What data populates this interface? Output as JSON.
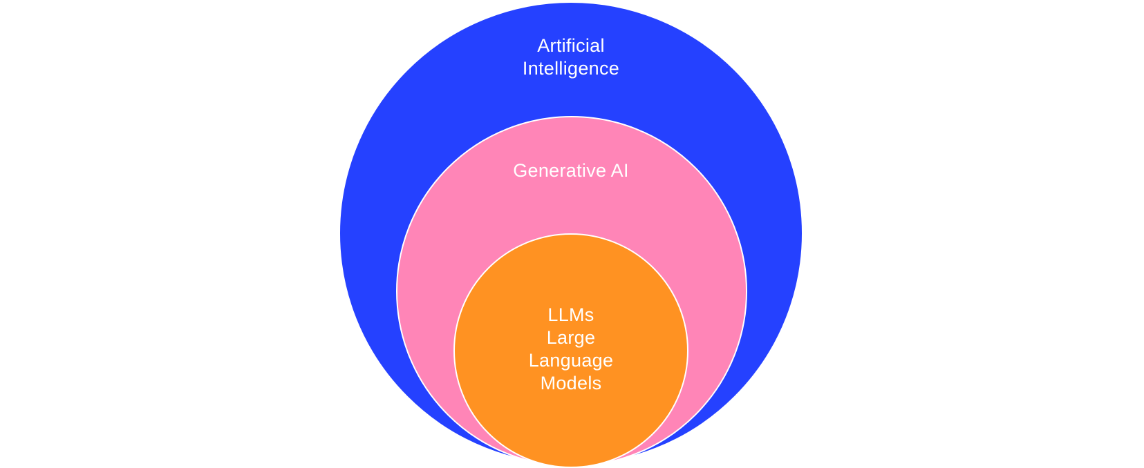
{
  "diagram": {
    "colors": {
      "outer": "#2541FF",
      "middle": "#FF85B7",
      "inner": "#FF9222",
      "text": "#FFFFFF",
      "background": "#FFFFFF"
    },
    "outer": {
      "lines": [
        "Artificial",
        "Intelligence"
      ]
    },
    "middle": {
      "lines": [
        "Generative AI"
      ]
    },
    "inner": {
      "lines": [
        "LLMs",
        "Large",
        "Language",
        "Models"
      ]
    }
  }
}
